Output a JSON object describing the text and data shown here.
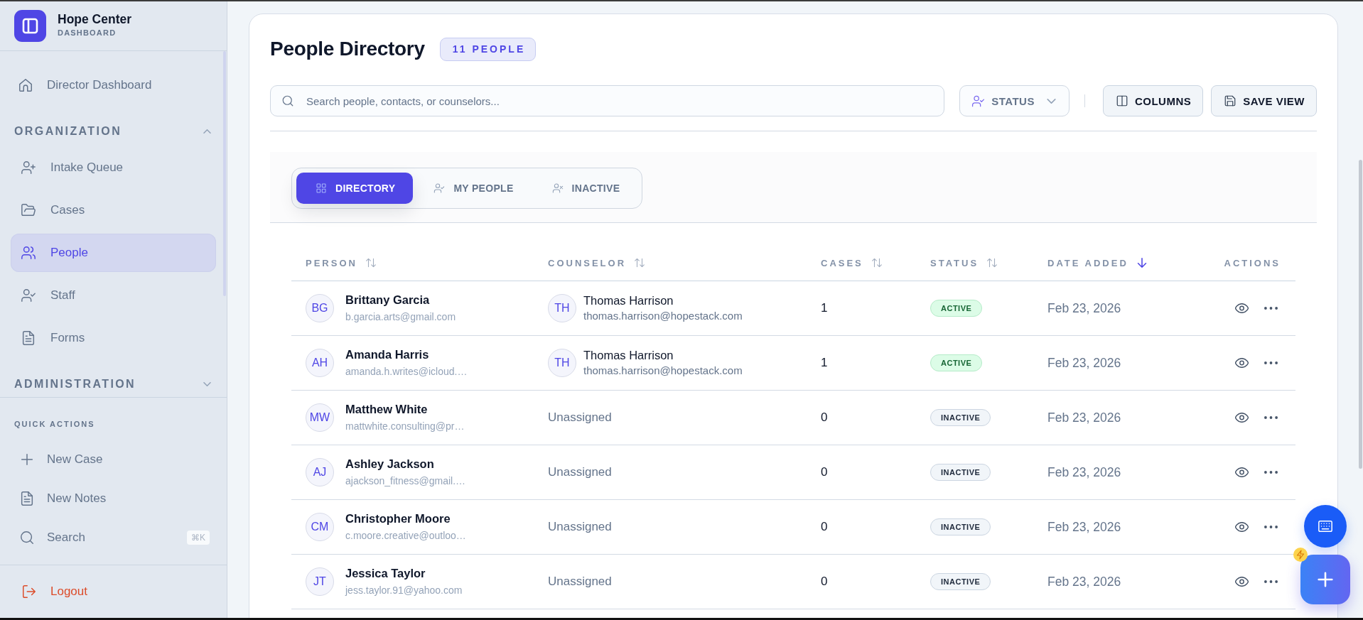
{
  "sidebar": {
    "brand": {
      "title": "Hope Center",
      "subtitle": "DASHBOARD"
    },
    "top_items": [
      {
        "label": "Director Dashboard",
        "selected": false
      }
    ],
    "sections": [
      {
        "title": "ORGANIZATION",
        "expanded": true,
        "items": [
          {
            "label": "Intake Queue",
            "selected": false
          },
          {
            "label": "Cases",
            "selected": false
          },
          {
            "label": "People",
            "selected": true
          },
          {
            "label": "Staff",
            "selected": false
          },
          {
            "label": "Forms",
            "selected": false
          }
        ]
      },
      {
        "title": "ADMINISTRATION",
        "expanded": false
      }
    ],
    "quick_actions": {
      "title": "QUICK ACTIONS",
      "items": [
        {
          "label": "New Case"
        },
        {
          "label": "New Notes"
        },
        {
          "label": "Search",
          "shortcut": "⌘K"
        }
      ]
    },
    "logout": {
      "label": "Logout"
    }
  },
  "page": {
    "title": "People Directory",
    "count_badge": "11 PEOPLE"
  },
  "toolbar": {
    "search": {
      "placeholder": "Search people, contacts, or counselors..."
    },
    "status_filter": {
      "label": "STATUS"
    },
    "buttons": [
      {
        "label": "COLUMNS"
      },
      {
        "label": "SAVE VIEW"
      }
    ]
  },
  "view_tabs": [
    {
      "label": "DIRECTORY",
      "selected": true
    },
    {
      "label": "MY PEOPLE",
      "selected": false
    },
    {
      "label": "INACTIVE",
      "selected": false
    }
  ],
  "table": {
    "columns": [
      {
        "label": "PERSON",
        "sortable": true,
        "sorted": false
      },
      {
        "label": "COUNSELOR",
        "sortable": true,
        "sorted": false
      },
      {
        "label": "CASES",
        "sortable": true,
        "sorted": false
      },
      {
        "label": "STATUS",
        "sortable": true,
        "sorted": false
      },
      {
        "label": "DATE ADDED",
        "sortable": true,
        "sorted": true
      },
      {
        "label": "ACTIONS",
        "sortable": false,
        "sorted": false
      }
    ],
    "rows": [
      {
        "initials": "BG",
        "name": "Brittany Garcia",
        "email": "b.garcia.arts@gmail.com",
        "counselor": {
          "kind": "assigned",
          "initials": "TH",
          "name": "Thomas Harrison",
          "email": "thomas.harrison@hopestack.com"
        },
        "cases": "1",
        "status": {
          "kind": "active",
          "label": "ACTIVE"
        },
        "date": "Feb 23, 2026"
      },
      {
        "initials": "AH",
        "name": "Amanda Harris",
        "email": "amanda.h.writes@icloud.…",
        "counselor": {
          "kind": "assigned",
          "initials": "TH",
          "name": "Thomas Harrison",
          "email": "thomas.harrison@hopestack.com"
        },
        "cases": "1",
        "status": {
          "kind": "active",
          "label": "ACTIVE"
        },
        "date": "Feb 23, 2026"
      },
      {
        "initials": "MW",
        "name": "Matthew White",
        "email": "mattwhite.consulting@pr…",
        "counselor": {
          "kind": "unassigned",
          "label": "Unassigned"
        },
        "cases": "0",
        "status": {
          "kind": "inactive",
          "label": "INACTIVE"
        },
        "date": "Feb 23, 2026"
      },
      {
        "initials": "AJ",
        "name": "Ashley Jackson",
        "email": "ajackson_fitness@gmail.…",
        "counselor": {
          "kind": "unassigned",
          "label": "Unassigned"
        },
        "cases": "0",
        "status": {
          "kind": "inactive",
          "label": "INACTIVE"
        },
        "date": "Feb 23, 2026"
      },
      {
        "initials": "CM",
        "name": "Christopher Moore",
        "email": "c.moore.creative@outloo…",
        "counselor": {
          "kind": "unassigned",
          "label": "Unassigned"
        },
        "cases": "0",
        "status": {
          "kind": "inactive",
          "label": "INACTIVE"
        },
        "date": "Feb 23, 2026"
      },
      {
        "initials": "JT",
        "name": "Jessica Taylor",
        "email": "jess.taylor.91@yahoo.com",
        "counselor": {
          "kind": "unassigned",
          "label": "Unassigned"
        },
        "cases": "0",
        "status": {
          "kind": "inactive",
          "label": "INACTIVE"
        },
        "date": "Feb 23, 2026"
      }
    ]
  }
}
